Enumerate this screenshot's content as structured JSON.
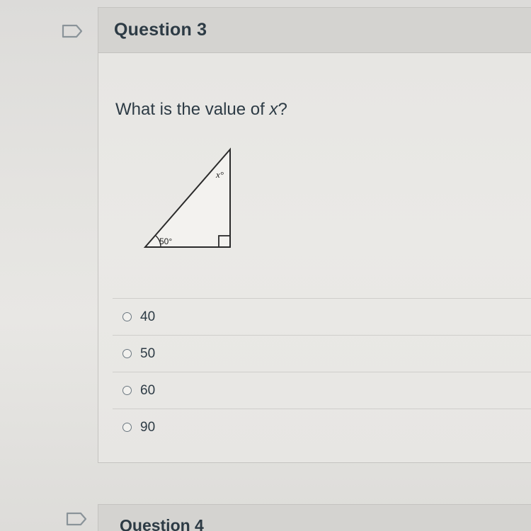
{
  "question3": {
    "title": "Question 3",
    "prompt": "What is the value of ",
    "prompt_var": "x",
    "prompt_end": "?",
    "diagram": {
      "angle_top_label": "x°",
      "angle_bottom_label": "50°"
    },
    "options": [
      {
        "label": "40"
      },
      {
        "label": "50"
      },
      {
        "label": "60"
      },
      {
        "label": "90"
      }
    ]
  },
  "question4": {
    "title": "Question 4"
  },
  "colors": {
    "text": "#2d3b45",
    "header_bg": "#d4d3d0",
    "card_bg": "#e8e7e4"
  }
}
